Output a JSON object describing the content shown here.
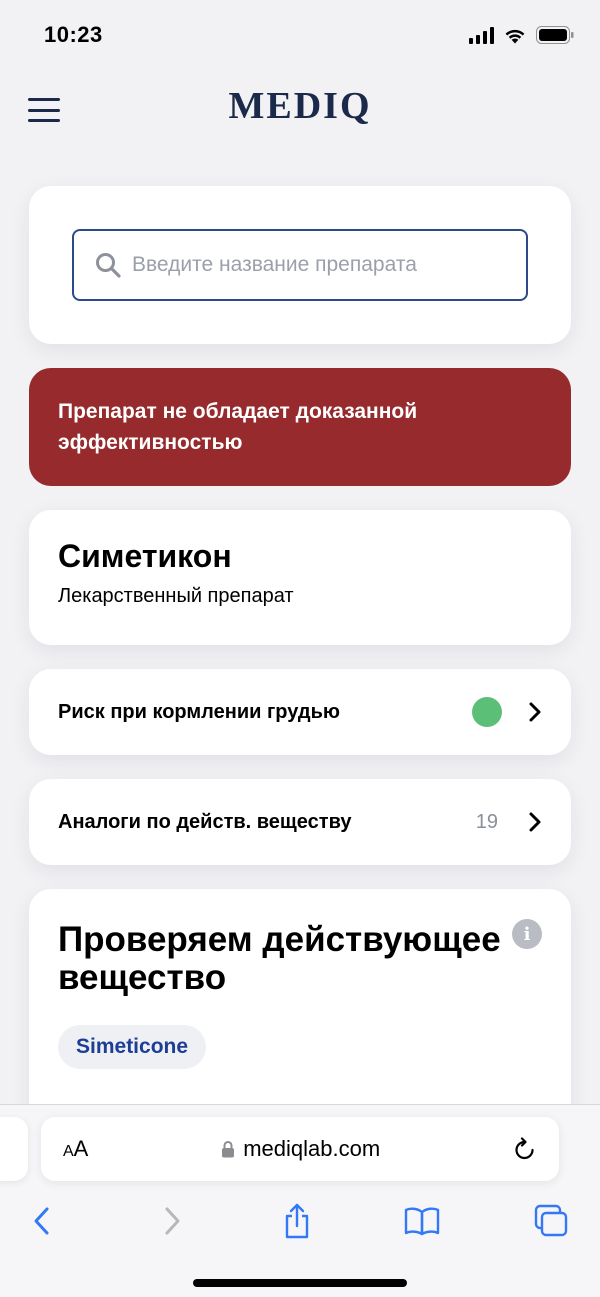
{
  "status": {
    "time": "10:23"
  },
  "header": {
    "logo": "MEDIQ"
  },
  "search": {
    "placeholder": "Введите название препарата"
  },
  "warning": {
    "text": "Препарат не обладает доказанной эффективностью"
  },
  "drug": {
    "name": "Симетикон",
    "type": "Лекарственный препарат"
  },
  "breastfeeding": {
    "label": "Риск при кормлении грудью",
    "status_color": "#5bbf77"
  },
  "analogs": {
    "label": "Аналоги по действ. веществу",
    "count": "19"
  },
  "active_substance": {
    "title": "Проверяем действующее вещество",
    "info_icon": "i",
    "substance": "Simeticone"
  },
  "browser": {
    "aa_small": "A",
    "aa_large": "A",
    "url": "mediqlab.com"
  },
  "colors": {
    "brand": "#1b2a4a",
    "warning": "#962a2c",
    "link": "#1d3e97",
    "ios_blue": "#3478f6"
  }
}
